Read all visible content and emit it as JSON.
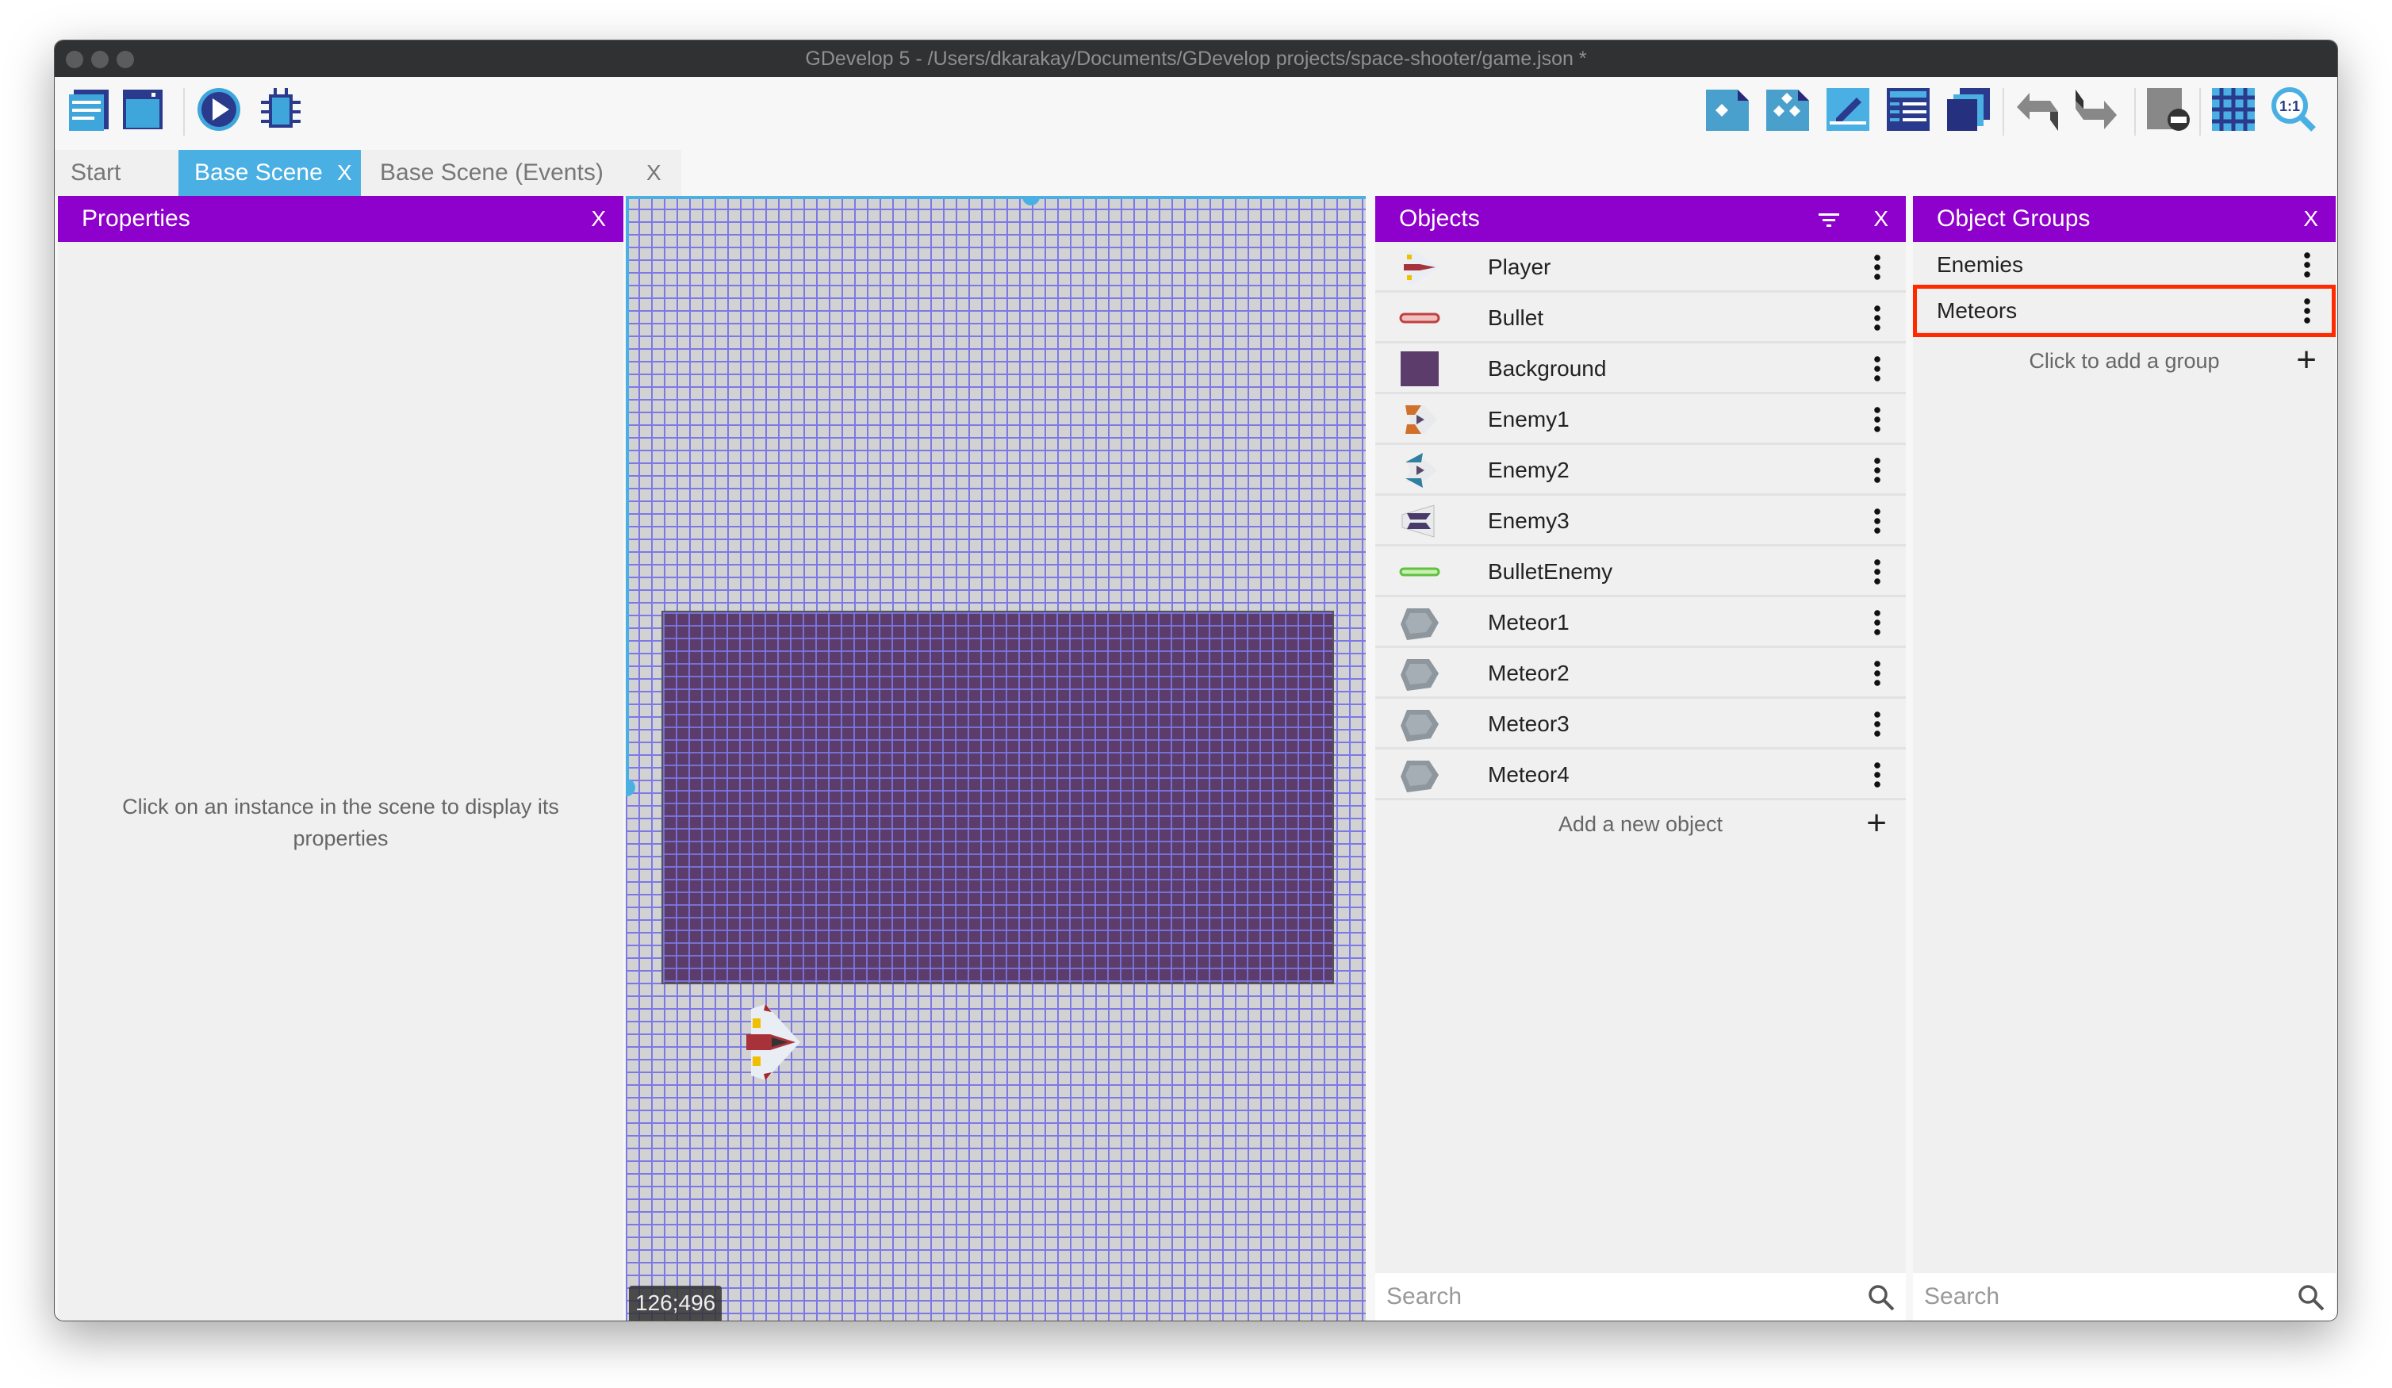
{
  "window": {
    "title": "GDevelop 5 - /Users/dkarakay/Documents/GDevelop projects/space-shooter/game.json *"
  },
  "toolbar": {
    "left_icons": [
      "project-manager-icon",
      "scene-icon",
      "preview-play-icon",
      "debugger-icon"
    ],
    "right_icons": [
      "object-icon",
      "object-groups-icon",
      "properties-edit-icon",
      "instances-list-icon",
      "layers-icon",
      "undo-icon",
      "redo-icon",
      "window-mask-icon",
      "grid-icon",
      "zoom-reset-icon"
    ]
  },
  "tabs": [
    {
      "label": "Start Page",
      "active": false,
      "closable": false
    },
    {
      "label": "Base Scene",
      "active": true,
      "closable": true
    },
    {
      "label": "Base Scene (Events)",
      "active": false,
      "closable": true
    }
  ],
  "close_glyph": "X",
  "properties": {
    "title": "Properties",
    "hint": "Click on an instance in the scene to display its properties"
  },
  "scene": {
    "coordinates": "126;496"
  },
  "objects": {
    "title": "Objects",
    "items": [
      {
        "name": "Player",
        "icon": "player-ship-icon"
      },
      {
        "name": "Bullet",
        "icon": "red-bullet-icon"
      },
      {
        "name": "Background",
        "icon": "background-icon"
      },
      {
        "name": "Enemy1",
        "icon": "orange-enemy-ship-icon"
      },
      {
        "name": "Enemy2",
        "icon": "blue-enemy-ship-icon"
      },
      {
        "name": "Enemy3",
        "icon": "purple-enemy-ship-icon"
      },
      {
        "name": "BulletEnemy",
        "icon": "green-bullet-icon"
      },
      {
        "name": "Meteor1",
        "icon": "meteor-icon"
      },
      {
        "name": "Meteor2",
        "icon": "meteor-icon"
      },
      {
        "name": "Meteor3",
        "icon": "meteor-icon"
      },
      {
        "name": "Meteor4",
        "icon": "meteor-icon"
      }
    ],
    "add_label": "Add a new object",
    "search_placeholder": "Search"
  },
  "groups": {
    "title": "Object Groups",
    "items": [
      {
        "name": "Enemies"
      },
      {
        "name": "Meteors",
        "highlighted": true
      }
    ],
    "add_label": "Click to add a group",
    "search_placeholder": "Search"
  },
  "colors": {
    "panel_header": "#8e00cb",
    "active_tab": "#4ab0e4",
    "highlight": "#ff2a00",
    "scene_background": "#5c3c6a"
  }
}
